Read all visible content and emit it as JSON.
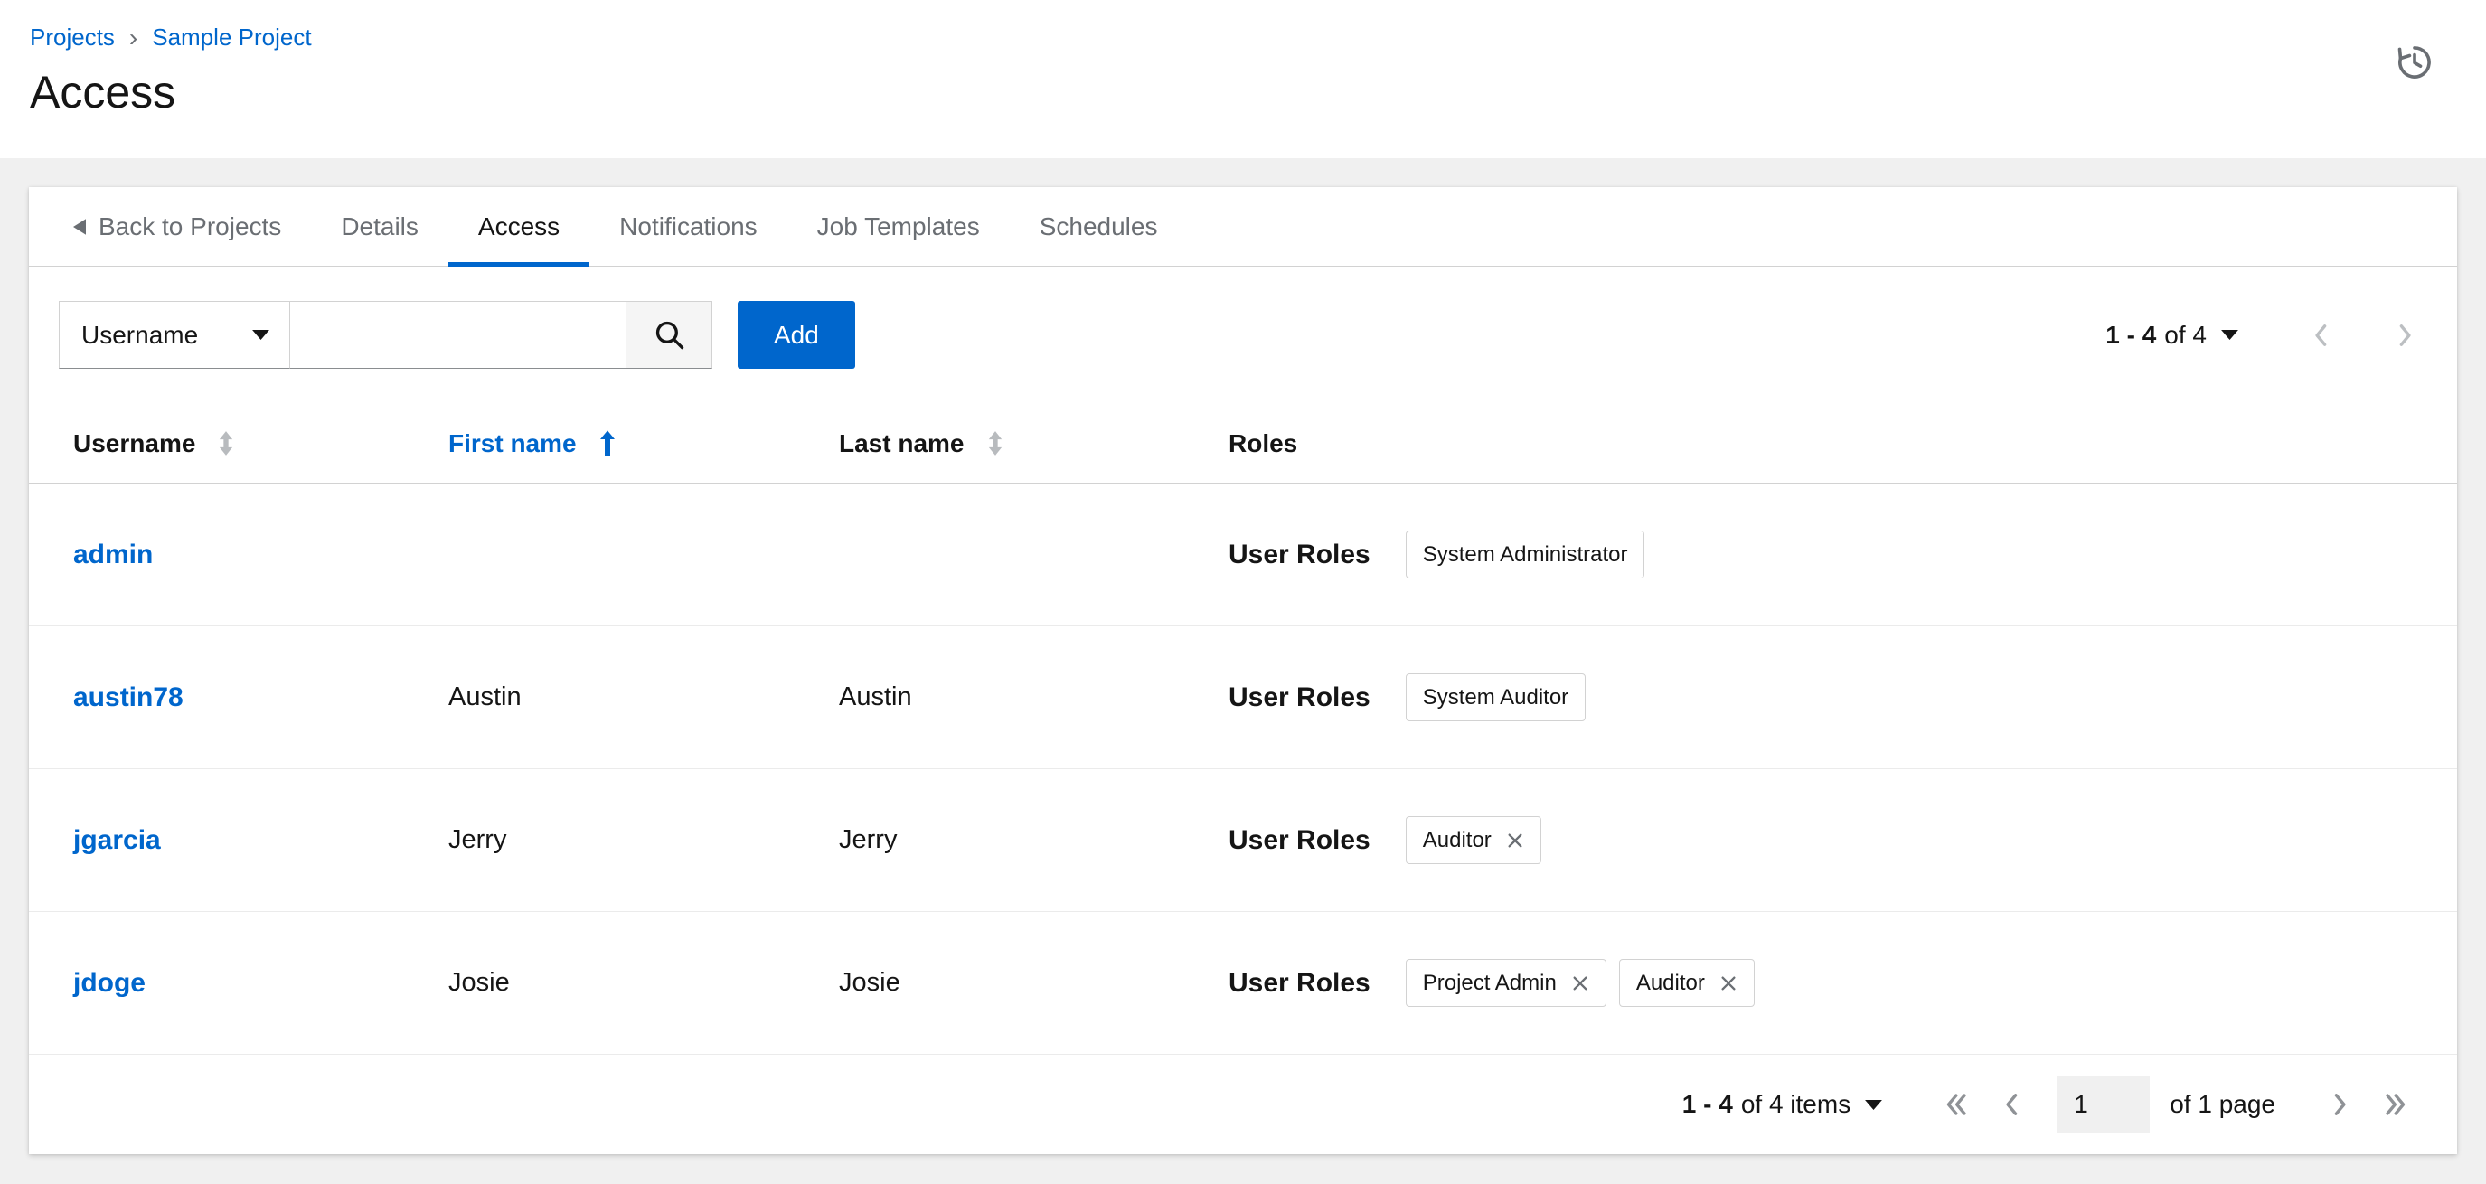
{
  "colors": {
    "accent": "#0066cc",
    "link": "#0066cc",
    "text": "#151515",
    "muted": "#6a6e73"
  },
  "breadcrumb": {
    "projects": "Projects",
    "separator": "›",
    "current": "Sample Project"
  },
  "page": {
    "title": "Access"
  },
  "tabs": {
    "back_label": "Back to Projects",
    "items": [
      {
        "label": "Details",
        "active": false
      },
      {
        "label": "Access",
        "active": true
      },
      {
        "label": "Notifications",
        "active": false
      },
      {
        "label": "Job Templates",
        "active": false
      },
      {
        "label": "Schedules",
        "active": false
      }
    ]
  },
  "toolbar": {
    "filter": {
      "selected": "Username"
    },
    "search": {
      "value": "",
      "placeholder": ""
    },
    "add_label": "Add",
    "pagination": {
      "range": "1 - 4",
      "suffix": "of 4"
    }
  },
  "table": {
    "headers": {
      "username": "Username",
      "first": "First name",
      "last": "Last name",
      "roles": "Roles"
    },
    "sort": {
      "column": "First name",
      "direction": "ascending"
    },
    "roles_label": "User Roles",
    "rows": [
      {
        "username": "admin",
        "first": "",
        "last": "",
        "chips": [
          {
            "label": "System Administrator",
            "removable": false
          }
        ]
      },
      {
        "username": "austin78",
        "first": "Austin",
        "last": "Austin",
        "chips": [
          {
            "label": "System Auditor",
            "removable": false
          }
        ]
      },
      {
        "username": "jgarcia",
        "first": "Jerry",
        "last": "Jerry",
        "chips": [
          {
            "label": "Auditor",
            "removable": true
          }
        ]
      },
      {
        "username": "jdoge",
        "first": "Josie",
        "last": "Josie",
        "chips": [
          {
            "label": "Project Admin",
            "removable": true
          },
          {
            "label": "Auditor",
            "removable": true
          }
        ]
      }
    ]
  },
  "footer": {
    "pagination": {
      "range": "1 - 4",
      "suffix": "of 4 items",
      "current_page": "1",
      "page_label": "of 1 page"
    }
  },
  "icons": {
    "history": "history-icon",
    "back": "back-arrow-icon",
    "caret": "chevron-down-icon",
    "search": "search-icon",
    "sort_unsorted": "sort-icon",
    "sort_asc": "sort-ascending-icon",
    "remove": "close-icon",
    "prev": "chevron-left-icon",
    "next": "chevron-right-icon",
    "first": "double-chevron-left-icon",
    "last": "double-chevron-right-icon"
  }
}
